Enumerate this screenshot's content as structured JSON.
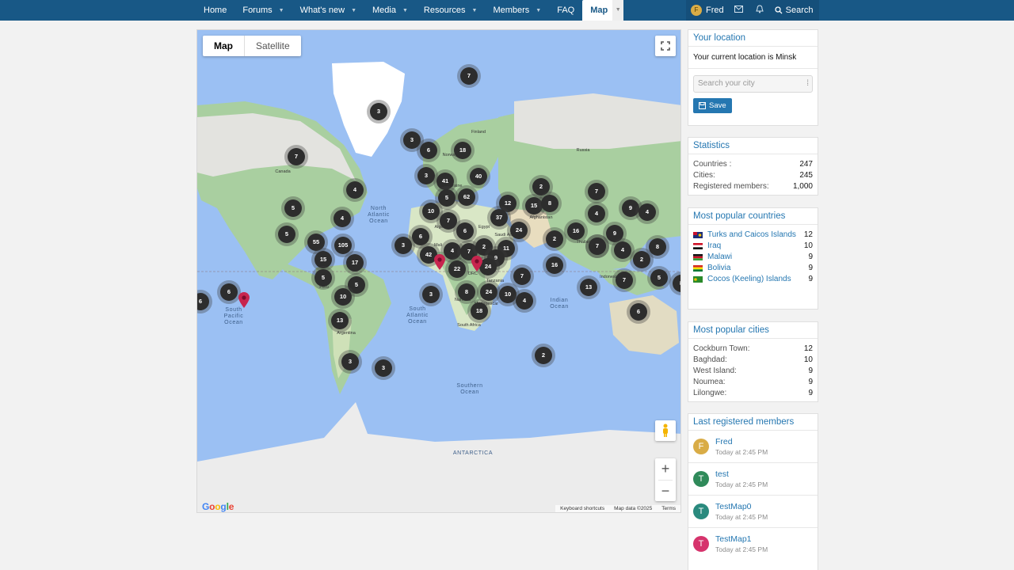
{
  "nav": {
    "items": [
      {
        "label": "Home",
        "caret": false
      },
      {
        "label": "Forums",
        "caret": true
      },
      {
        "label": "What's new",
        "caret": true
      },
      {
        "label": "Media",
        "caret": true
      },
      {
        "label": "Resources",
        "caret": true
      },
      {
        "label": "Members",
        "caret": true
      },
      {
        "label": "FAQ",
        "caret": false
      }
    ],
    "active": "Map",
    "user": {
      "name": "Fred",
      "initial": "F"
    },
    "search_label": "Search"
  },
  "map": {
    "type_map": "Map",
    "type_satellite": "Satellite",
    "google": "Google",
    "attribution": [
      "Keyboard shortcuts",
      "Map data ©2025",
      "Terms"
    ],
    "labels": [
      {
        "text": "North\nAtlantic\nOcean"
      },
      {
        "text": "South\nPacific\nOcean"
      },
      {
        "text": "South\nAtlantic\nOcean"
      },
      {
        "text": "Indian\nOcean"
      },
      {
        "text": "Southern\nOcean"
      },
      {
        "text": "ANTARCTICA"
      },
      {
        "text": "Canada"
      },
      {
        "text": "Peru"
      },
      {
        "text": "Argentina"
      },
      {
        "text": "Tanzania"
      },
      {
        "text": "Namibia"
      },
      {
        "text": "Madagascar"
      },
      {
        "text": "South Africa"
      },
      {
        "text": "Egypt"
      },
      {
        "text": "Saudi Arabia"
      },
      {
        "text": "Algeria"
      },
      {
        "text": "Finland"
      },
      {
        "text": "Norway"
      },
      {
        "text": "Ukraine"
      },
      {
        "text": "Russia"
      },
      {
        "text": "Thailand"
      },
      {
        "text": "Indonesia"
      },
      {
        "text": "DRC"
      },
      {
        "text": "Mali"
      },
      {
        "text": "Afghanistan"
      }
    ],
    "clusters": [
      {
        "n": "7"
      },
      {
        "n": "3"
      },
      {
        "n": "3"
      },
      {
        "n": "6"
      },
      {
        "n": "18"
      },
      {
        "n": "7"
      },
      {
        "n": "3"
      },
      {
        "n": "41"
      },
      {
        "n": "40"
      },
      {
        "n": "5"
      },
      {
        "n": "62"
      },
      {
        "n": "4"
      },
      {
        "n": "5"
      },
      {
        "n": "4"
      },
      {
        "n": "10"
      },
      {
        "n": "7"
      },
      {
        "n": "12"
      },
      {
        "n": "2"
      },
      {
        "n": "15"
      },
      {
        "n": "8"
      },
      {
        "n": "7"
      },
      {
        "n": "37"
      },
      {
        "n": "6"
      },
      {
        "n": "24"
      },
      {
        "n": "5"
      },
      {
        "n": "55"
      },
      {
        "n": "105"
      },
      {
        "n": "6"
      },
      {
        "n": "3"
      },
      {
        "n": "42"
      },
      {
        "n": "4"
      },
      {
        "n": "7"
      },
      {
        "n": "2"
      },
      {
        "n": "11"
      },
      {
        "n": "15"
      },
      {
        "n": "17"
      },
      {
        "n": "22"
      },
      {
        "n": "9"
      },
      {
        "n": "24"
      },
      {
        "n": "2"
      },
      {
        "n": "16"
      },
      {
        "n": "4"
      },
      {
        "n": "9"
      },
      {
        "n": "14"
      },
      {
        "n": "4"
      },
      {
        "n": "8"
      },
      {
        "n": "2"
      },
      {
        "n": "16"
      },
      {
        "n": "7"
      },
      {
        "n": "5"
      },
      {
        "n": "5"
      },
      {
        "n": "6"
      },
      {
        "n": "10"
      },
      {
        "n": "3"
      },
      {
        "n": "8"
      },
      {
        "n": "24"
      },
      {
        "n": "10"
      },
      {
        "n": "4"
      },
      {
        "n": "7"
      },
      {
        "n": "13"
      },
      {
        "n": "7"
      },
      {
        "n": "5"
      },
      {
        "n": "18"
      },
      {
        "n": "13"
      },
      {
        "n": "6"
      },
      {
        "n": "3"
      },
      {
        "n": "3"
      },
      {
        "n": "2"
      },
      {
        "n": "9"
      },
      {
        "n": "4"
      },
      {
        "n": "6"
      },
      {
        "n": "8"
      }
    ]
  },
  "location": {
    "title": "Your location",
    "current": "Your current location is Minsk",
    "placeholder": "Search your city",
    "save": "Save"
  },
  "statistics": {
    "title": "Statistics",
    "rows": [
      {
        "k": "Countries :",
        "v": "247"
      },
      {
        "k": "Cities:",
        "v": "245"
      },
      {
        "k": "Registered members:",
        "v": "1,000"
      }
    ]
  },
  "popular_countries": {
    "title": "Most popular countries",
    "rows": [
      {
        "name": "Turks and Caicos Islands",
        "v": "12",
        "flag": "tc"
      },
      {
        "name": "Iraq",
        "v": "10",
        "flag": "iq"
      },
      {
        "name": "Malawi",
        "v": "9",
        "flag": "mw"
      },
      {
        "name": "Bolivia",
        "v": "9",
        "flag": "bo"
      },
      {
        "name": "Cocos (Keeling) Islands",
        "v": "9",
        "flag": "cc"
      }
    ]
  },
  "popular_cities": {
    "title": "Most popular cities",
    "rows": [
      {
        "k": "Cockburn Town:",
        "v": "12"
      },
      {
        "k": "Baghdad:",
        "v": "10"
      },
      {
        "k": "West Island:",
        "v": "9"
      },
      {
        "k": "Noumea:",
        "v": "9"
      },
      {
        "k": "Lilongwe:",
        "v": "9"
      }
    ]
  },
  "members": {
    "title": "Last registered members",
    "rows": [
      {
        "name": "Fred",
        "time": "Today at 2:45 PM",
        "initial": "F",
        "color": "#d9ac46"
      },
      {
        "name": "test",
        "time": "Today at 2:45 PM",
        "initial": "T",
        "color": "#2f8a5a"
      },
      {
        "name": "TestMap0",
        "time": "Today at 2:45 PM",
        "initial": "T",
        "color": "#2a8a7e"
      },
      {
        "name": "TestMap1",
        "time": "Today at 2:45 PM",
        "initial": "T",
        "color": "#d6336c"
      }
    ]
  }
}
